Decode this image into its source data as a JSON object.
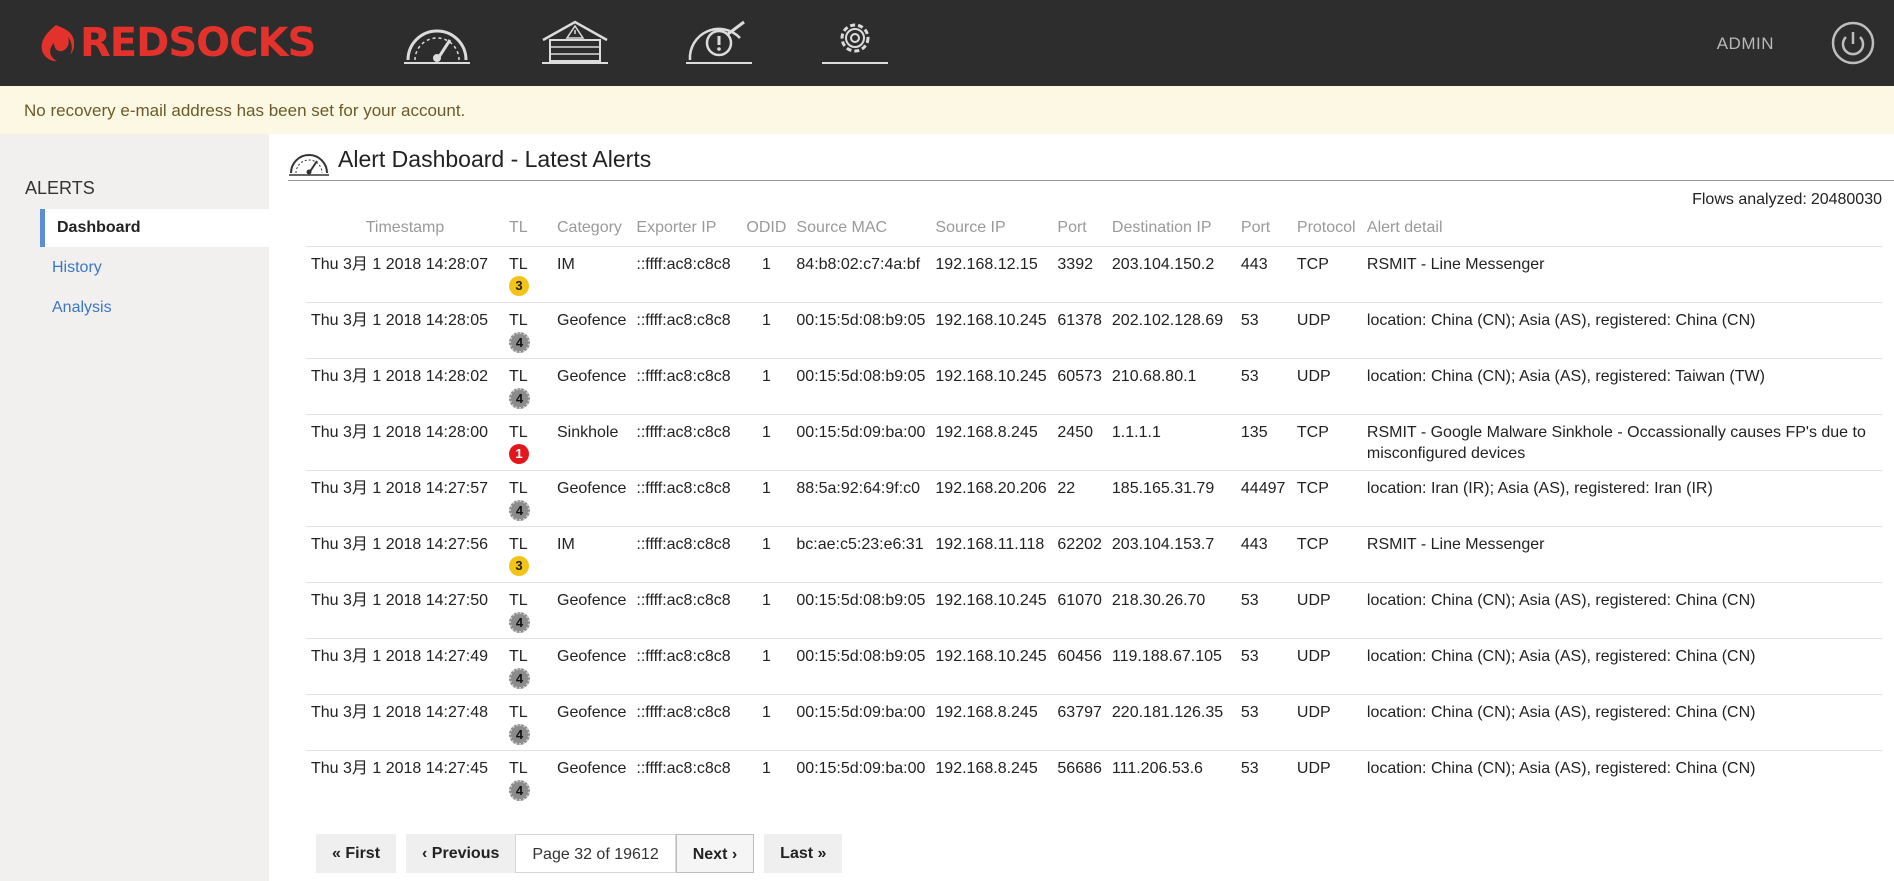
{
  "brand": {
    "name": "REDSOCKS",
    "color": "#e3322c"
  },
  "header": {
    "nav_icons": [
      "dashboard-gauge-icon",
      "warehouse-alert-icon",
      "analysis-magnifier-icon",
      "settings-gear-icon"
    ],
    "user_label": "ADMIN",
    "logout_icon": "power-icon"
  },
  "notice": {
    "text": "No recovery e-mail address has been set for your account."
  },
  "sidebar": {
    "heading": "ALERTS",
    "items": [
      {
        "label": "Dashboard",
        "active": true
      },
      {
        "label": "History",
        "active": false
      },
      {
        "label": "Analysis",
        "active": false
      }
    ]
  },
  "main": {
    "title": "Alert Dashboard - Latest Alerts",
    "flows_label": "Flows analyzed:",
    "flows_value": "20480030"
  },
  "table": {
    "columns": [
      "Timestamp",
      "TL",
      "Category",
      "Exporter IP",
      "ODID",
      "Source MAC",
      "Source IP",
      "Port",
      "Destination IP",
      "Port",
      "Protocol",
      "Alert detail"
    ],
    "rows": [
      {
        "timestamp": "Thu 3月 1 2018 14:28:07",
        "tl": "TL",
        "level": "3",
        "category": "IM",
        "exporter_ip": "::ffff:ac8:c8c8",
        "odid": "1",
        "source_mac": "84:b8:02:c7:4a:bf",
        "source_ip": "192.168.12.15",
        "source_port": "3392",
        "dest_ip": "203.104.150.2",
        "dest_port": "443",
        "protocol": "TCP",
        "detail": "RSMIT - Line Messenger"
      },
      {
        "timestamp": "Thu 3月 1 2018 14:28:05",
        "tl": "TL",
        "level": "4",
        "category": "Geofence",
        "exporter_ip": "::ffff:ac8:c8c8",
        "odid": "1",
        "source_mac": "00:15:5d:08:b9:05",
        "source_ip": "192.168.10.245",
        "source_port": "61378",
        "dest_ip": "202.102.128.69",
        "dest_port": "53",
        "protocol": "UDP",
        "detail": "location: China (CN); Asia (AS), registered: China (CN)"
      },
      {
        "timestamp": "Thu 3月 1 2018 14:28:02",
        "tl": "TL",
        "level": "4",
        "category": "Geofence",
        "exporter_ip": "::ffff:ac8:c8c8",
        "odid": "1",
        "source_mac": "00:15:5d:08:b9:05",
        "source_ip": "192.168.10.245",
        "source_port": "60573",
        "dest_ip": "210.68.80.1",
        "dest_port": "53",
        "protocol": "UDP",
        "detail": "location: China (CN); Asia (AS), registered: Taiwan (TW)"
      },
      {
        "timestamp": "Thu 3月 1 2018 14:28:00",
        "tl": "TL",
        "level": "1",
        "category": "Sinkhole",
        "exporter_ip": "::ffff:ac8:c8c8",
        "odid": "1",
        "source_mac": "00:15:5d:09:ba:00",
        "source_ip": "192.168.8.245",
        "source_port": "2450",
        "dest_ip": "1.1.1.1",
        "dest_port": "135",
        "protocol": "TCP",
        "detail": "RSMIT - Google Malware Sinkhole - Occassionally causes FP's due to misconfigured devices"
      },
      {
        "timestamp": "Thu 3月 1 2018 14:27:57",
        "tl": "TL",
        "level": "4",
        "category": "Geofence",
        "exporter_ip": "::ffff:ac8:c8c8",
        "odid": "1",
        "source_mac": "88:5a:92:64:9f:c0",
        "source_ip": "192.168.20.206",
        "source_port": "22",
        "dest_ip": "185.165.31.79",
        "dest_port": "44497",
        "protocol": "TCP",
        "detail": "location: Iran (IR); Asia (AS), registered: Iran (IR)"
      },
      {
        "timestamp": "Thu 3月 1 2018 14:27:56",
        "tl": "TL",
        "level": "3",
        "category": "IM",
        "exporter_ip": "::ffff:ac8:c8c8",
        "odid": "1",
        "source_mac": "bc:ae:c5:23:e6:31",
        "source_ip": "192.168.11.118",
        "source_port": "62202",
        "dest_ip": "203.104.153.7",
        "dest_port": "443",
        "protocol": "TCP",
        "detail": "RSMIT - Line Messenger"
      },
      {
        "timestamp": "Thu 3月 1 2018 14:27:50",
        "tl": "TL",
        "level": "4",
        "category": "Geofence",
        "exporter_ip": "::ffff:ac8:c8c8",
        "odid": "1",
        "source_mac": "00:15:5d:08:b9:05",
        "source_ip": "192.168.10.245",
        "source_port": "61070",
        "dest_ip": "218.30.26.70",
        "dest_port": "53",
        "protocol": "UDP",
        "detail": "location: China (CN); Asia (AS), registered: China (CN)"
      },
      {
        "timestamp": "Thu 3月 1 2018 14:27:49",
        "tl": "TL",
        "level": "4",
        "category": "Geofence",
        "exporter_ip": "::ffff:ac8:c8c8",
        "odid": "1",
        "source_mac": "00:15:5d:08:b9:05",
        "source_ip": "192.168.10.245",
        "source_port": "60456",
        "dest_ip": "119.188.67.105",
        "dest_port": "53",
        "protocol": "UDP",
        "detail": "location: China (CN); Asia (AS), registered: China (CN)"
      },
      {
        "timestamp": "Thu 3月 1 2018 14:27:48",
        "tl": "TL",
        "level": "4",
        "category": "Geofence",
        "exporter_ip": "::ffff:ac8:c8c8",
        "odid": "1",
        "source_mac": "00:15:5d:09:ba:00",
        "source_ip": "192.168.8.245",
        "source_port": "63797",
        "dest_ip": "220.181.126.35",
        "dest_port": "53",
        "protocol": "UDP",
        "detail": "location: China (CN); Asia (AS), registered: China (CN)"
      },
      {
        "timestamp": "Thu 3月 1 2018 14:27:45",
        "tl": "TL",
        "level": "4",
        "category": "Geofence",
        "exporter_ip": "::ffff:ac8:c8c8",
        "odid": "1",
        "source_mac": "00:15:5d:09:ba:00",
        "source_ip": "192.168.8.245",
        "source_port": "56686",
        "dest_ip": "111.206.53.6",
        "dest_port": "53",
        "protocol": "UDP",
        "detail": "location: China (CN); Asia (AS), registered: China (CN)"
      }
    ]
  },
  "pagination": {
    "first": "« First",
    "previous": "‹ Previous",
    "info": "Page 32 of 19612",
    "next": "Next ›",
    "last": "Last »"
  }
}
